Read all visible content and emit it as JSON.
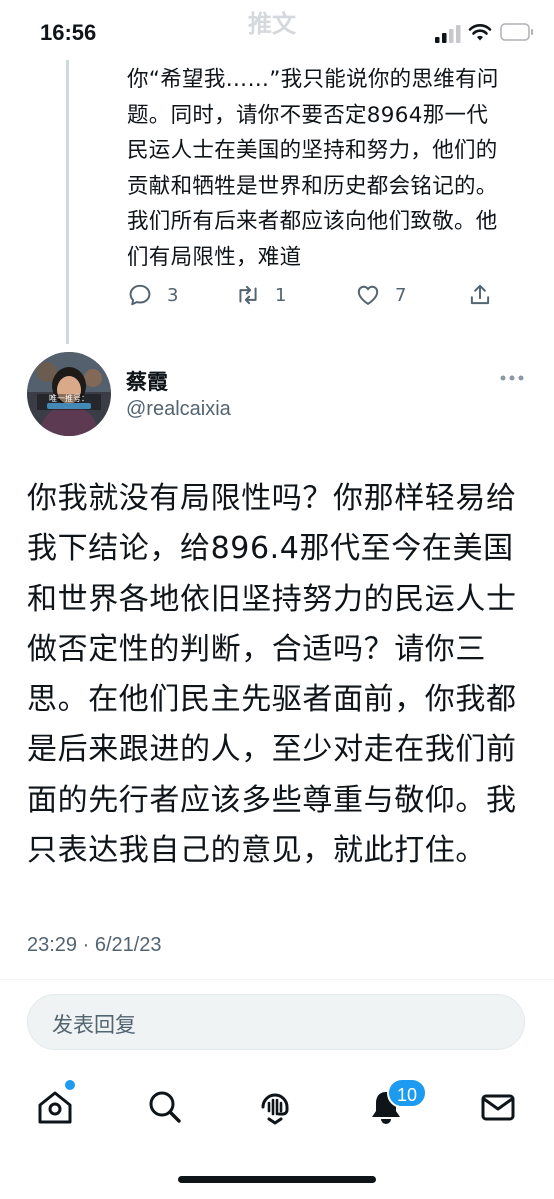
{
  "status_bar": {
    "time": "16:56",
    "faded_title": "推文"
  },
  "previous_tweet": {
    "text": "你“希望我……”我只能说你的思维有问题。同时，请你不要否定8964那一代民运人士在美国的坚持和努力，他们的贡献和牺牲是世界和历史都会铭记的。我们所有后来者都应该向他们致敬。他们有局限性，难道",
    "reply_count": "3",
    "retweet_count": "1",
    "like_count": "7"
  },
  "tweet": {
    "author_name": "蔡霞",
    "author_handle": "@realcaixia",
    "avatar_caption": "唯一推号：",
    "text": "你我就没有局限性吗？你那样轻易给我下结论，给896.4那代至今在美国和世界各地依旧坚持努力的民运人士做否定性的判断，合适吗？请你三思。在他们民主先驱者面前，你我都是后来跟进的人，至少对走在我们前面的先行者应该多些尊重与敬仰。我只表达我自己的意见，就此打住。",
    "timestamp": "23:29 · 6/21/23"
  },
  "reply_box": {
    "placeholder": "发表回复"
  },
  "tab_bar": {
    "items": [
      "home-icon",
      "search-icon",
      "spaces-icon",
      "notifications-icon",
      "messages-icon"
    ],
    "notifications_badge": "10"
  },
  "colors": {
    "accent": "#1d9bf0",
    "text": "#0f1419",
    "secondary": "#536471",
    "thread_line": "#cfd9de"
  }
}
